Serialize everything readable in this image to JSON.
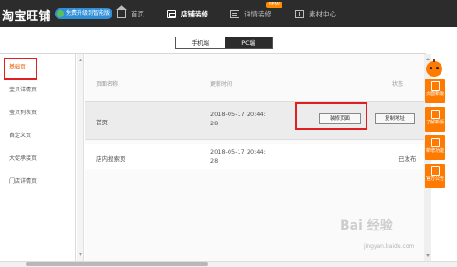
{
  "header": {
    "logo": "淘宝旺铺",
    "badge": "免费升级到智能版",
    "nav": [
      {
        "label": "首页",
        "icon": "home-icon"
      },
      {
        "label": "店铺装修",
        "icon": "store-icon"
      },
      {
        "label": "详情装修",
        "icon": "detail-icon",
        "tag": "NEW"
      },
      {
        "label": "素材中心",
        "icon": "asset-icon"
      }
    ]
  },
  "view_toggle": {
    "mobile": "手机端",
    "pc": "PC端",
    "selected": "PC端"
  },
  "sidebar": {
    "items": [
      {
        "label": "基础页",
        "active": true
      },
      {
        "label": "宝贝详情页"
      },
      {
        "label": "宝贝列表页"
      },
      {
        "label": "自定义页"
      },
      {
        "label": "大促承接页"
      },
      {
        "label": "门店详情页"
      }
    ]
  },
  "table": {
    "columns": {
      "name": "页面名称",
      "time": "更新时间",
      "status": "状态"
    },
    "rows": [
      {
        "name": "首页",
        "time_line1": "2018-05-17 20:44:",
        "time_line2": "28",
        "decorate_label": "装修页面",
        "copy_label": "复制地址"
      },
      {
        "name": "店内搜索页",
        "time_line1": "2018-05-17 20:44:",
        "time_line2": "28",
        "status": "已发布"
      }
    ]
  },
  "right_toolbar": [
    {
      "label": "页面新版",
      "icon": "page-icon"
    },
    {
      "label": "了解新版",
      "icon": "info-icon"
    },
    {
      "label": "新增功能",
      "icon": "feature-icon"
    },
    {
      "label": "官方公告",
      "icon": "notice-icon"
    }
  ],
  "watermark": {
    "text": "Bai 经验",
    "url": "jingyan.baidu.com"
  },
  "colors": {
    "topbar": "#2c2c2c",
    "accent": "#ff7a00",
    "highlight": "#e02020",
    "badge": "#2f8fd8"
  }
}
